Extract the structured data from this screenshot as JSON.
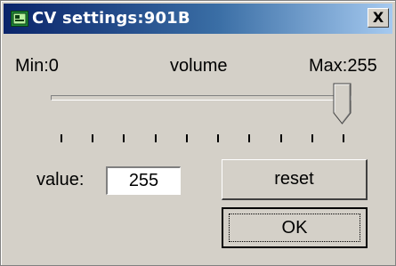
{
  "window": {
    "title": "CV settings:901B",
    "close_label": "X"
  },
  "slider": {
    "min_label": "Min:0",
    "name_label": "volume",
    "max_label": "Max:255",
    "min": 0,
    "max": 255,
    "value": 255,
    "tick_count": 10
  },
  "value_field": {
    "label": "value:",
    "value": "255"
  },
  "buttons": {
    "reset_label": "reset",
    "ok_label": "OK"
  }
}
